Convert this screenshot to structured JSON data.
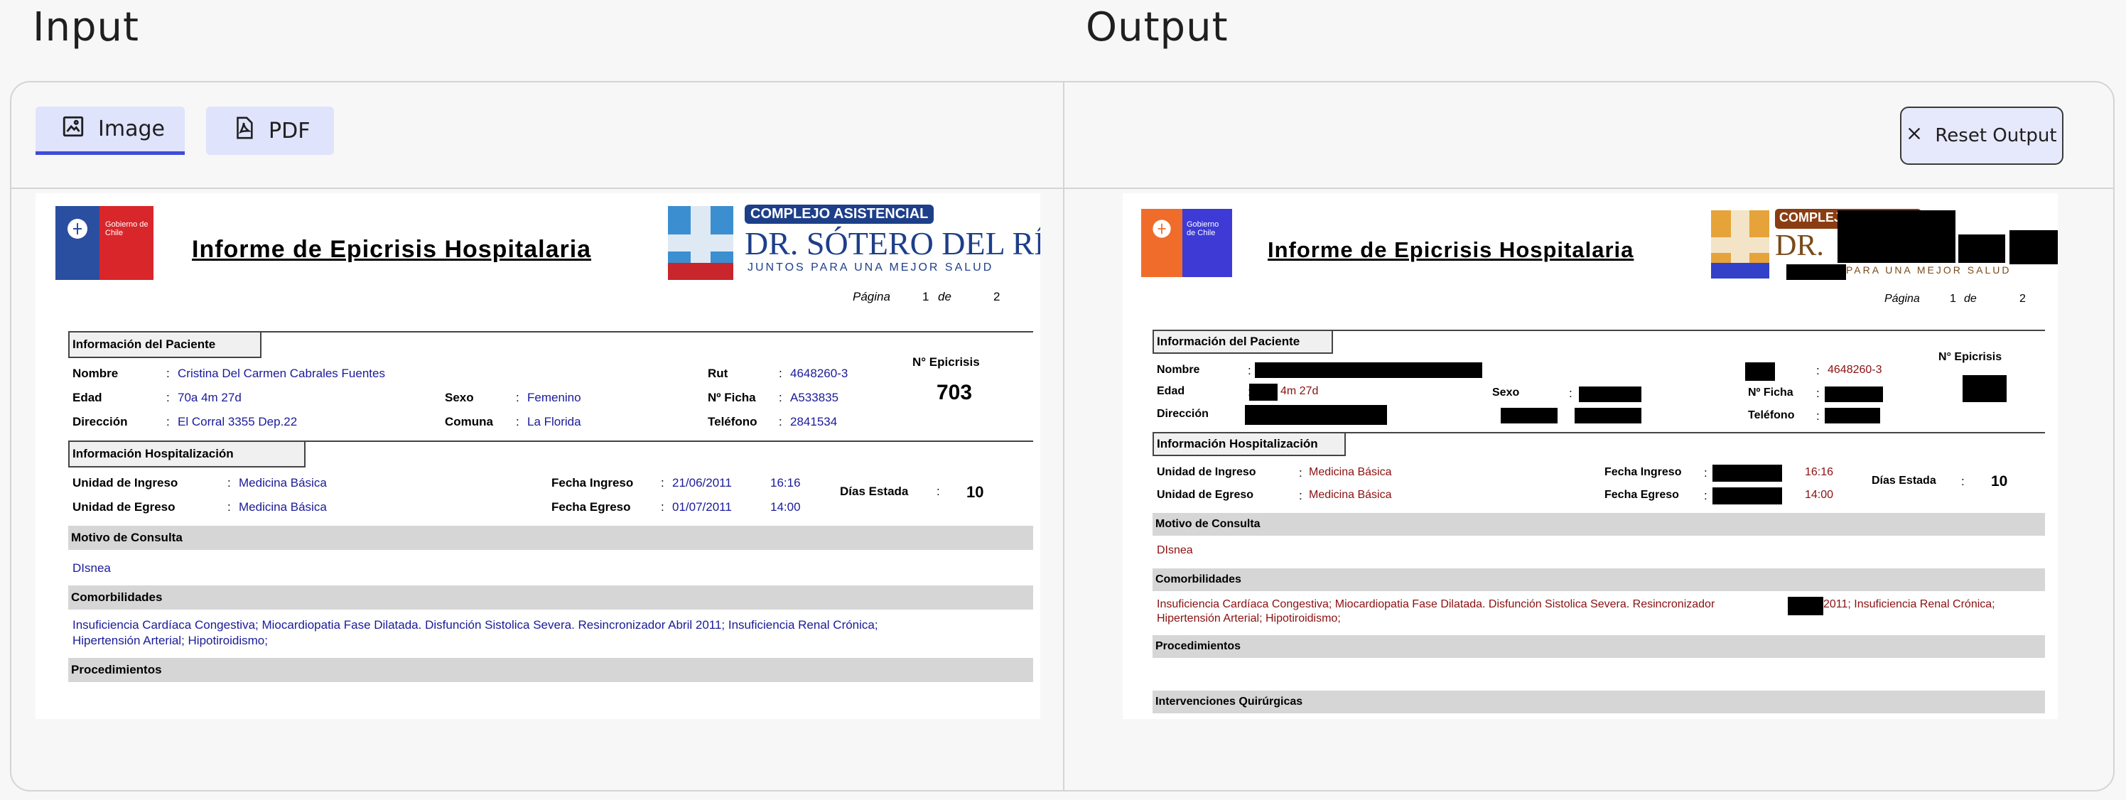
{
  "header": {
    "input_title": "Input",
    "output_title": "Output"
  },
  "tabs": [
    {
      "label": "Image",
      "icon": "image-icon"
    },
    {
      "label": "PDF",
      "icon": "pdf-icon"
    }
  ],
  "reset_button": {
    "label": "Reset Output",
    "icon": "close-icon"
  },
  "colors": {
    "accent": "#3f4bd8",
    "tab_bg": "#dfe3fb",
    "input_text": "#1a1a9a",
    "output_text": "#8a1010"
  },
  "doc_in": {
    "gob_logo": "Gobierno de Chile",
    "title": "Informe de Epicrisis Hospitalaria",
    "hospital_top": "COMPLEJO ASISTENCIAL",
    "hospital_name": "DR. SÓTERO DEL RÍO",
    "hospital_tag": "JUNTOS PARA UNA MEJOR SALUD",
    "page_label": "Página",
    "page_num": "1",
    "page_de": "de",
    "page_total": "2",
    "sec_paciente": "Información del Paciente",
    "nombre_l": "Nombre",
    "nombre_v": "Cristina Del Carmen Cabrales Fuentes",
    "edad_l": "Edad",
    "edad_v": "70a 4m 27d",
    "direccion_l": "Dirección",
    "direccion_v": "El Corral 3355 Dep.22",
    "sexo_l": "Sexo",
    "sexo_v": "Femenino",
    "comuna_l": "Comuna",
    "comuna_v": "La Florida",
    "rut_l": "Rut",
    "rut_v": "4648260-3",
    "ficha_l": "Nº Ficha",
    "ficha_v": "A533835",
    "telefono_l": "Teléfono",
    "telefono_v": "2841534",
    "epicrisis_l": "N° Epicrisis",
    "epicrisis_v": "703",
    "sec_hosp": "Información Hospitalización",
    "ingreso_l": "Unidad de Ingreso",
    "ingreso_v": "Medicina Básica",
    "egreso_l": "Unidad de Egreso",
    "egreso_v": "Medicina Básica",
    "f_ingreso_l": "Fecha Ingreso",
    "f_ingreso_v": "21/06/2011",
    "h_ingreso": "16:16",
    "f_egreso_l": "Fecha Egreso",
    "f_egreso_v": "01/07/2011",
    "h_egreso": "14:00",
    "dias_l": "Días Estada",
    "dias_v": "10",
    "motivo_l": "Motivo de Consulta",
    "motivo_v": "DIsnea",
    "comorb_l": "Comorbilidades",
    "comorb_v1": "Insuficiencia Cardíaca Congestiva; Miocardiopatia Fase Dilatada. Disfunción Sistolica Severa. Resincronizador Abril 2011; Insuficiencia Renal Crónica;",
    "comorb_v2": "Hipertensión Arterial; Hipotiroidismo;",
    "proced_l": "Procedimientos"
  },
  "doc_out": {
    "gob_logo": "Gobierno de Chile",
    "title": "Informe de Epicrisis Hospitalaria",
    "hospital_top": "COMPLEJO",
    "hospital_name": "DR.",
    "hospital_tag": "PARA UNA MEJOR SALUD",
    "page_label": "Página",
    "page_num": "1",
    "page_de": "de",
    "page_total": "2",
    "sec_paciente": "Información del Paciente",
    "nombre_l": "Nombre",
    "edad_l": "Edad",
    "edad_v": "4m 27d",
    "direccion_l": "Dirección",
    "sexo_l": "Sexo",
    "rut_v": "4648260-3",
    "ficha_l": "Nº Ficha",
    "telefono_l": "Teléfono",
    "epicrisis_l": "N° Epicrisis",
    "sec_hosp": "Información Hospitalización",
    "ingreso_l": "Unidad de Ingreso",
    "ingreso_v": "Medicina Básica",
    "egreso_l": "Unidad de Egreso",
    "egreso_v": "Medicina Básica",
    "f_ingreso_l": "Fecha Ingreso",
    "h_ingreso": "16:16",
    "f_egreso_l": "Fecha Egreso",
    "h_egreso": "14:00",
    "dias_l": "Días Estada",
    "dias_v": "10",
    "motivo_l": "Motivo de Consulta",
    "motivo_v": "DIsnea",
    "comorb_l": "Comorbilidades",
    "comorb_v1a": "Insuficiencia Cardíaca Congestiva; Miocardiopatia Fase Dilatada. Disfunción Sistolica Severa. Resincronizador",
    "comorb_v1b": "2011; Insuficiencia Renal Crónica;",
    "comorb_v2": "Hipertensión Arterial; Hipotiroidismo;",
    "proced_l": "Procedimientos",
    "interv_l": "Intervenciones Quirúrgicas"
  }
}
